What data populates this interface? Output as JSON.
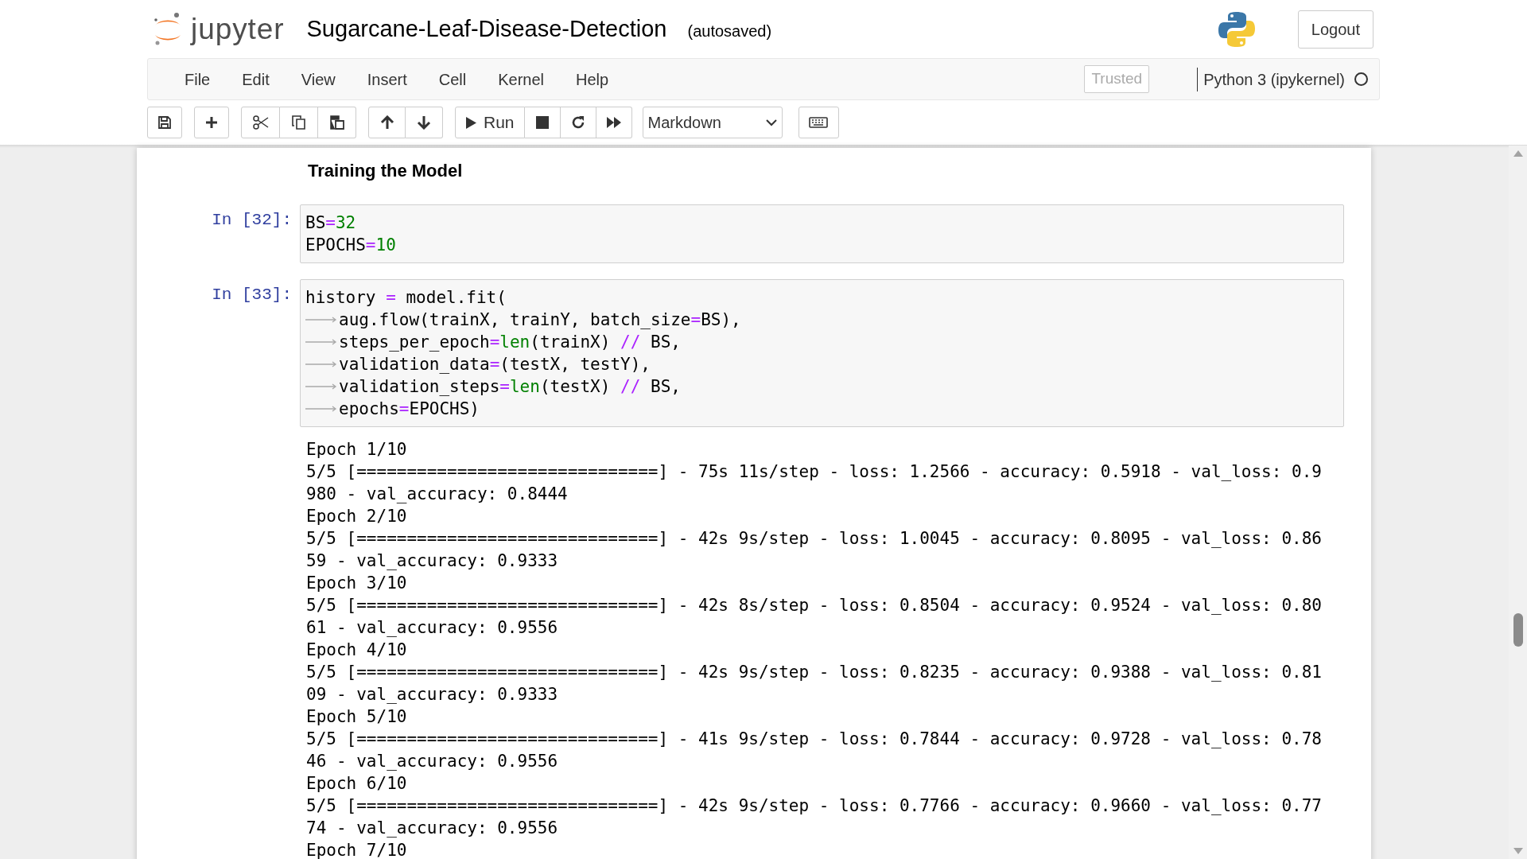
{
  "header": {
    "logo_text": "jupyter",
    "notebook_name": "Sugarcane-Leaf-Disease-Detection",
    "save_status": "(autosaved)",
    "logout": "Logout"
  },
  "menu": [
    "File",
    "Edit",
    "View",
    "Insert",
    "Cell",
    "Kernel",
    "Help"
  ],
  "trusted": "Trusted",
  "kernel": {
    "name": "Python 3 (ipykernel)",
    "busy": false
  },
  "toolbar": {
    "run_label": "Run",
    "cell_type": "Markdown"
  },
  "cells": [
    {
      "kind": "markdown",
      "heading": "Training the Model"
    },
    {
      "kind": "code",
      "prompt": "In [32]:",
      "lines": [
        {
          "tab": false,
          "tokens": [
            {
              "kind": "name",
              "s": "BS"
            },
            {
              "kind": "op",
              "s": "="
            },
            {
              "kind": "num",
              "s": "32"
            }
          ]
        },
        {
          "tab": false,
          "tokens": [
            {
              "kind": "name",
              "s": "EPOCHS"
            },
            {
              "kind": "op",
              "s": "="
            },
            {
              "kind": "num",
              "s": "10"
            }
          ]
        }
      ]
    },
    {
      "kind": "code",
      "prompt": "In [33]:",
      "lines": [
        {
          "tab": false,
          "tokens": [
            {
              "kind": "name",
              "s": "history "
            },
            {
              "kind": "op",
              "s": "="
            },
            {
              "kind": "name",
              "s": " model.fit("
            }
          ]
        },
        {
          "tab": true,
          "tokens": [
            {
              "kind": "name",
              "s": "aug.flow(trainX, trainY, batch_size"
            },
            {
              "kind": "op",
              "s": "="
            },
            {
              "kind": "name",
              "s": "BS),"
            }
          ]
        },
        {
          "tab": true,
          "tokens": [
            {
              "kind": "name",
              "s": "steps_per_epoch"
            },
            {
              "kind": "op",
              "s": "="
            },
            {
              "kind": "builtin",
              "s": "len"
            },
            {
              "kind": "name",
              "s": "(trainX) "
            },
            {
              "kind": "op",
              "s": "//"
            },
            {
              "kind": "name",
              "s": " BS,"
            }
          ]
        },
        {
          "tab": true,
          "tokens": [
            {
              "kind": "name",
              "s": "validation_data"
            },
            {
              "kind": "op",
              "s": "="
            },
            {
              "kind": "name",
              "s": "(testX, testY),"
            }
          ]
        },
        {
          "tab": true,
          "tokens": [
            {
              "kind": "name",
              "s": "validation_steps"
            },
            {
              "kind": "op",
              "s": "="
            },
            {
              "kind": "builtin",
              "s": "len"
            },
            {
              "kind": "name",
              "s": "(testX) "
            },
            {
              "kind": "op",
              "s": "//"
            },
            {
              "kind": "name",
              "s": " BS,"
            }
          ]
        },
        {
          "tab": true,
          "tokens": [
            {
              "kind": "name",
              "s": "epochs"
            },
            {
              "kind": "op",
              "s": "="
            },
            {
              "kind": "name",
              "s": "EPOCHS)"
            }
          ]
        }
      ],
      "output": [
        "Epoch 1/10",
        "5/5 [==============================] - 75s 11s/step - loss: 1.2566 - accuracy: 0.5918 - val_loss: 0.9",
        "980 - val_accuracy: 0.8444",
        "Epoch 2/10",
        "5/5 [==============================] - 42s 9s/step - loss: 1.0045 - accuracy: 0.8095 - val_loss: 0.86",
        "59 - val_accuracy: 0.9333",
        "Epoch 3/10",
        "5/5 [==============================] - 42s 8s/step - loss: 0.8504 - accuracy: 0.9524 - val_loss: 0.80",
        "61 - val_accuracy: 0.9556",
        "Epoch 4/10",
        "5/5 [==============================] - 42s 9s/step - loss: 0.8235 - accuracy: 0.9388 - val_loss: 0.81",
        "09 - val_accuracy: 0.9333",
        "Epoch 5/10",
        "5/5 [==============================] - 41s 9s/step - loss: 0.7844 - accuracy: 0.9728 - val_loss: 0.78",
        "46 - val_accuracy: 0.9556",
        "Epoch 6/10",
        "5/5 [==============================] - 42s 9s/step - loss: 0.7766 - accuracy: 0.9660 - val_loss: 0.77",
        "74 - val_accuracy: 0.9556",
        "Epoch 7/10"
      ]
    }
  ]
}
